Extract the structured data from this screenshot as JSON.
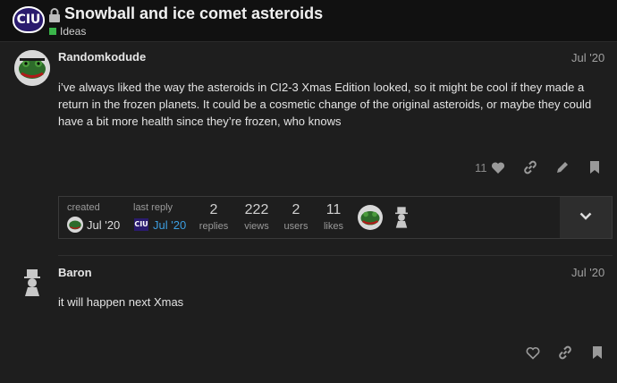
{
  "header": {
    "logo_text": "CIU",
    "title": "Snowball and ice comet asteroids",
    "category": "Ideas",
    "category_color": "#3ab54a"
  },
  "post1": {
    "username": "Randomkodude",
    "date": "Jul '20",
    "body": "i’ve always liked the way the asteroids in CI2-3 Xmas Edition looked, so it might be cool if they made a return in the frozen planets. It could be a cosmetic change of the original asteroids, or maybe they could have a bit more health since they’re frozen, who knows",
    "like_count": "11"
  },
  "topic_map": {
    "created_label": "created",
    "created_date": "Jul '20",
    "last_reply_label": "last reply",
    "last_reply_date": "Jul '20",
    "replies": {
      "value": "2",
      "label": "replies"
    },
    "views": {
      "value": "222",
      "label": "views"
    },
    "users": {
      "value": "2",
      "label": "users"
    },
    "likes": {
      "value": "11",
      "label": "likes"
    }
  },
  "post2": {
    "username": "Baron",
    "date": "Jul '20",
    "body": "it will happen next Xmas"
  },
  "colors": {
    "background": "#1e1e1e",
    "header": "#111111",
    "link": "#3c9ee0"
  }
}
